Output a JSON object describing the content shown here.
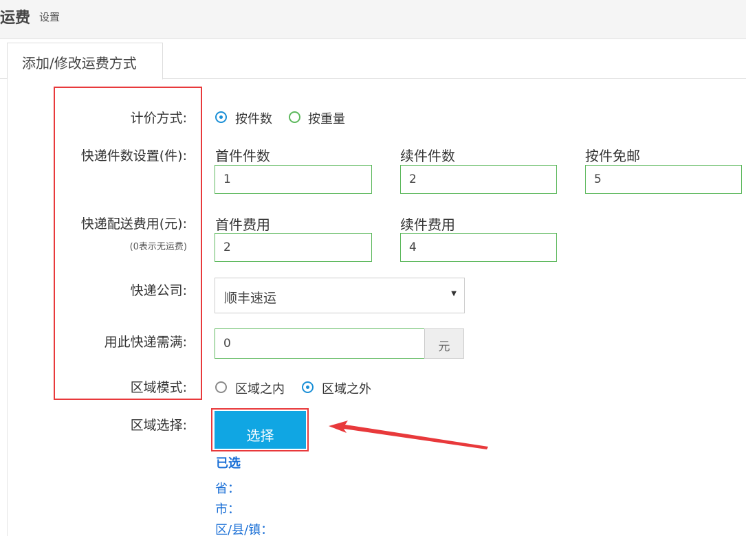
{
  "header": {
    "title": "运费",
    "subtitle": "设置"
  },
  "tab": {
    "label": "添加/修改运费方式"
  },
  "pricing": {
    "label": "计价方式:",
    "options": [
      {
        "label": "按件数",
        "checked": true
      },
      {
        "label": "按重量",
        "checked": false
      }
    ]
  },
  "count_settings": {
    "label": "快递件数设置(件):",
    "fields": [
      {
        "title": "首件件数",
        "value": "1"
      },
      {
        "title": "续件件数",
        "value": "2"
      },
      {
        "title": "按件免邮",
        "value": "5"
      }
    ]
  },
  "fee_settings": {
    "label": "快递配送费用(元):",
    "hint": "(0表示无运费)",
    "fields": [
      {
        "title": "首件费用",
        "value": "2"
      },
      {
        "title": "续件费用",
        "value": "4"
      }
    ]
  },
  "courier": {
    "label": "快递公司:",
    "selected": "顺丰速运"
  },
  "minimum": {
    "label": "用此快递需满:",
    "value": "0",
    "unit": "元"
  },
  "region_mode": {
    "label": "区域模式:",
    "options": [
      {
        "label": "区域之内",
        "checked": false
      },
      {
        "label": "区域之外",
        "checked": true
      }
    ]
  },
  "region_select": {
    "label": "区域选择:",
    "button_label": "选择",
    "selected_title": "已选",
    "lines": [
      "省：",
      "市：",
      "区/县/镇："
    ]
  },
  "colors": {
    "accent": "#10a6e3",
    "highlight": "#e8393b",
    "input_border": "#5cb85c",
    "link": "#1a6fd6"
  }
}
